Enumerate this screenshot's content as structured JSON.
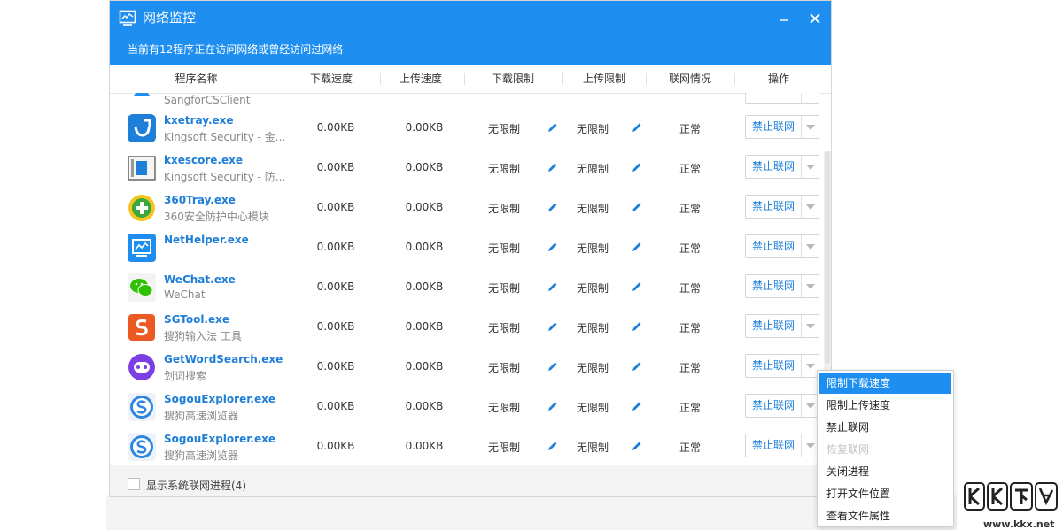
{
  "window": {
    "title": "网络监控",
    "subtitle": "当前有12程序正在访问网络或曾经访问过网络",
    "minimize_icon": "minimize-icon",
    "close_icon": "close-icon"
  },
  "columns": {
    "name": "程序名称",
    "download_speed": "下载速度",
    "upload_speed": "上传速度",
    "download_limit": "下载限制",
    "upload_limit": "上传限制",
    "network_status": "联网情况",
    "action": "操作"
  },
  "partial_row": {
    "desc": "SangforCSClient"
  },
  "rows": [
    {
      "name": "kxetray.exe",
      "desc": "Kingsoft Security - 金...",
      "down": "0.00KB",
      "up": "0.00KB",
      "dl_limit": "无限制",
      "ul_limit": "无限制",
      "status": "正常",
      "action": "禁止联网",
      "icon": "kingsoft-tray-icon"
    },
    {
      "name": "kxescore.exe",
      "desc": "Kingsoft Security - 防...",
      "down": "0.00KB",
      "up": "0.00KB",
      "dl_limit": "无限制",
      "ul_limit": "无限制",
      "status": "正常",
      "action": "禁止联网",
      "icon": "kingsoft-core-icon"
    },
    {
      "name": "360Tray.exe",
      "desc": "360安全防护中心模块",
      "down": "0.00KB",
      "up": "0.00KB",
      "dl_limit": "无限制",
      "ul_limit": "无限制",
      "status": "正常",
      "action": "禁止联网",
      "icon": "360-icon"
    },
    {
      "name": "NetHelper.exe",
      "desc": "",
      "down": "0.00KB",
      "up": "0.00KB",
      "dl_limit": "无限制",
      "ul_limit": "无限制",
      "status": "正常",
      "action": "禁止联网",
      "icon": "nethelper-icon"
    },
    {
      "name": "WeChat.exe",
      "desc": "WeChat",
      "down": "0.00KB",
      "up": "0.00KB",
      "dl_limit": "无限制",
      "ul_limit": "无限制",
      "status": "正常",
      "action": "禁止联网",
      "icon": "wechat-icon"
    },
    {
      "name": "SGTool.exe",
      "desc": "搜狗输入法 工具",
      "down": "0.00KB",
      "up": "0.00KB",
      "dl_limit": "无限制",
      "ul_limit": "无限制",
      "status": "正常",
      "action": "禁止联网",
      "icon": "sogou-input-icon"
    },
    {
      "name": "GetWordSearch.exe",
      "desc": "划词搜索",
      "down": "0.00KB",
      "up": "0.00KB",
      "dl_limit": "无限制",
      "ul_limit": "无限制",
      "status": "正常",
      "action": "禁止联网",
      "icon": "getword-icon"
    },
    {
      "name": "SogouExplorer.exe",
      "desc": "搜狗高速浏览器",
      "down": "0.00KB",
      "up": "0.00KB",
      "dl_limit": "无限制",
      "ul_limit": "无限制",
      "status": "正常",
      "action": "禁止联网",
      "icon": "sogou-explorer-icon"
    },
    {
      "name": "SogouExplorer.exe",
      "desc": "搜狗高速浏览器",
      "down": "0.00KB",
      "up": "0.00KB",
      "dl_limit": "无限制",
      "ul_limit": "无限制",
      "status": "正常",
      "action": "禁止联网",
      "icon": "sogou-explorer-icon"
    }
  ],
  "footer": {
    "show_system_label": "显示系统联网进程(4)",
    "checked": false
  },
  "context_menu": {
    "items": [
      {
        "label": "限制下载速度",
        "state": "active"
      },
      {
        "label": "限制上传速度",
        "state": "normal"
      },
      {
        "label": "禁止联网",
        "state": "normal"
      },
      {
        "label": "恢复联网",
        "state": "disabled"
      },
      {
        "label": "关闭进程",
        "state": "normal"
      },
      {
        "label": "打开文件位置",
        "state": "normal"
      },
      {
        "label": "查看文件属性",
        "state": "normal"
      }
    ]
  },
  "watermark": {
    "text": "www.kkx.net"
  },
  "colors": {
    "accent": "#1e8ff0",
    "link": "#1e7fd8"
  }
}
